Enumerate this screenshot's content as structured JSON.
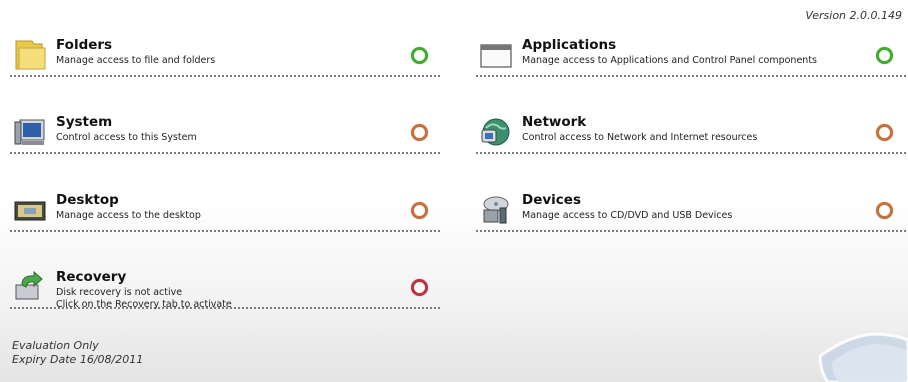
{
  "version": "Version 2.0.0.149",
  "tiles": {
    "folders": {
      "title": "Folders",
      "desc": "Manage access to file and folders",
      "status": "green",
      "icon": "folder-icon"
    },
    "applications": {
      "title": "Applications",
      "desc": "Manage access to Applications and Control Panel components",
      "status": "green",
      "icon": "window-icon"
    },
    "system": {
      "title": "System",
      "desc": "Control access to this System",
      "status": "orange",
      "icon": "computer-icon"
    },
    "network": {
      "title": "Network",
      "desc": "Control access to Network and Internet resources",
      "status": "orange",
      "icon": "network-globe-icon"
    },
    "desktop": {
      "title": "Desktop",
      "desc": "Manage access to the desktop",
      "status": "orange",
      "icon": "desktop-icon"
    },
    "devices": {
      "title": "Devices",
      "desc": "Manage access to CD/DVD and USB Devices",
      "status": "orange",
      "icon": "devices-icon"
    },
    "recovery": {
      "title": "Recovery",
      "desc": "Disk recovery is not active",
      "desc2": "Click on the Recovery tab to activate",
      "status": "red",
      "icon": "recovery-arrow-icon"
    }
  },
  "footer": {
    "line1": "Evaluation Only",
    "line2": "Expiry Date 16/08/2011"
  },
  "colors": {
    "green": "#3fae2a",
    "orange": "#c7703a",
    "red": "#c0303a"
  }
}
